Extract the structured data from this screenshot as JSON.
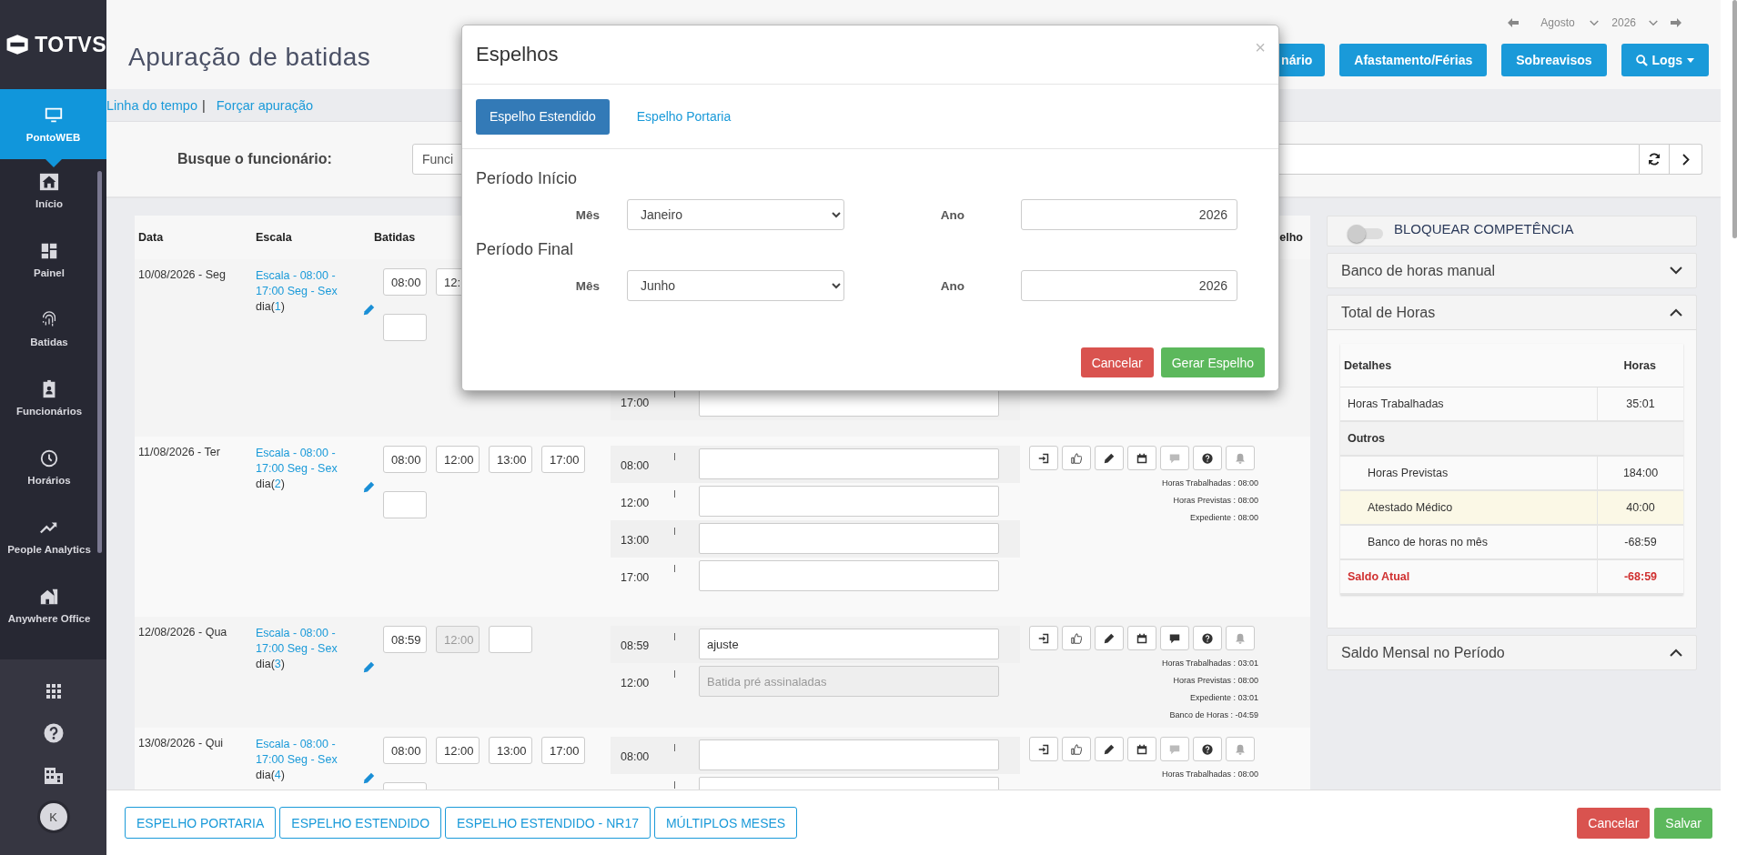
{
  "sidebar": {
    "logo": "TOTVS",
    "avatar": "K",
    "items": [
      {
        "label": "PontoWEB",
        "selected": true
      },
      {
        "label": "Início",
        "selected": false
      },
      {
        "label": "Painel",
        "selected": false
      },
      {
        "label": "Batidas",
        "selected": false
      },
      {
        "label": "Funcionários",
        "selected": false
      },
      {
        "label": "Horários",
        "selected": false
      },
      {
        "label": "People Analytics",
        "selected": false
      },
      {
        "label": "Anywhere Office",
        "selected": false
      }
    ]
  },
  "header": {
    "title": "Apuração de batidas",
    "period": {
      "month": "Agosto",
      "year": "2026"
    },
    "buttons": [
      "nário",
      "Afastamento/Férias",
      "Sobreavisos",
      "Logs"
    ]
  },
  "links": {
    "items": [
      "Linha do tempo",
      "Forçar apuração"
    ],
    "separator": "|"
  },
  "search": {
    "label": "Busque o funcionário:",
    "placeholder": "Funci"
  },
  "table": {
    "columns": [
      "Data",
      "Escala",
      "Batidas",
      "elho"
    ],
    "rows": [
      {
        "date": "10/08/2026 - Seg",
        "escala": "Escala - 08:00 - 17:00 Seg - Sex",
        "day": [
          "dia(",
          "1",
          ")"
        ],
        "punches": [
          {
            "value": "08:00",
            "disabled": false
          },
          {
            "value": "12:",
            "disabled": false
          },
          {
            "break": true,
            "disabled": false
          }
        ],
        "marks": [
          {
            "time": "17:00",
            "disabled": false
          }
        ]
      },
      {
        "date": "11/08/2026 - Ter",
        "escala": "Escala - 08:00 - 17:00 Seg - Sex",
        "day": [
          "dia(",
          "2",
          ")"
        ],
        "punches": [
          {
            "value": "08:00",
            "disabled": false
          },
          {
            "value": "12:00",
            "disabled": false
          },
          {
            "value": "13:00",
            "disabled": false
          },
          {
            "value": "17:00",
            "disabled": false
          },
          {
            "break": true,
            "disabled": false
          }
        ],
        "marks": [
          {
            "time": "08:00",
            "disabled": false
          },
          {
            "time": "12:00",
            "disabled": false
          },
          {
            "time": "13:00",
            "disabled": false
          },
          {
            "time": "17:00",
            "disabled": false
          }
        ],
        "actions": {
          "comment_active": false
        },
        "summary": [
          "Horas Trabalhadas : 08:00",
          "Horas Previstas : 08:00",
          "Expediente : 08:00"
        ]
      },
      {
        "date": "12/08/2026 - Qua",
        "escala": "Escala - 08:00 - 17:00 Seg - Sex",
        "day": [
          "dia(",
          "3",
          ")"
        ],
        "punches": [
          {
            "value": "08:59",
            "disabled": false
          },
          {
            "value": "12:00",
            "disabled": true
          },
          {
            "disabled": false
          }
        ],
        "marks": [
          {
            "time": "08:59",
            "text": "ajuste",
            "disabled": false
          },
          {
            "time": "12:00",
            "placeholder": "Batida pré assinaladas",
            "disabled": true
          }
        ],
        "actions": {
          "comment_active": true
        },
        "summary": [
          "Horas Trabalhadas : 03:01",
          "Horas Previstas : 08:00",
          "Expediente : 03:01",
          "Banco de Horas : -04:59"
        ]
      },
      {
        "date": "13/08/2026 - Qui",
        "escala": "Escala - 08:00 - 17:00 Seg - Sex",
        "day": [
          "dia(",
          "4",
          ")"
        ],
        "punches": [
          {
            "value": "08:00",
            "disabled": false
          },
          {
            "value": "12:00",
            "disabled": false
          },
          {
            "value": "13:00",
            "disabled": false
          },
          {
            "value": "17:00",
            "disabled": false
          },
          {
            "break": true,
            "disabled": false
          }
        ],
        "marks": [
          {
            "time": "08:00",
            "disabled": false
          },
          {
            "disabled": false
          }
        ],
        "actions": {
          "comment_active": false
        },
        "summary": [
          "Horas Trabalhadas : 08:00"
        ]
      }
    ]
  },
  "side_panel": {
    "toggle": {
      "label": "BLOQUEAR COMPETÊNCIA",
      "on": false
    },
    "sections": [
      {
        "title": "Banco de horas manual",
        "expanded": false
      },
      {
        "title": "Total de Horas",
        "expanded": true
      },
      {
        "title": "Saldo Mensal no Período",
        "expanded": true
      }
    ],
    "totals": {
      "columns": [
        "Detalhes",
        "Horas"
      ],
      "rows": [
        {
          "kind": "item",
          "label": "Horas Trabalhadas",
          "value": "35:01",
          "highlighted": false
        },
        {
          "kind": "group",
          "label": "Outros",
          "highlighted": false
        },
        {
          "kind": "sub",
          "label": "Horas Previstas",
          "value": "184:00",
          "highlighted": false
        },
        {
          "kind": "sub",
          "label": "Atestado Médico",
          "value": "40:00",
          "highlighted": true
        },
        {
          "kind": "sub",
          "label": "Banco de horas no mês",
          "value": "-68:59",
          "highlighted": false
        },
        {
          "kind": "total",
          "label": "Saldo Atual",
          "value": "-68:59",
          "highlighted": false
        }
      ]
    }
  },
  "footer": {
    "buttons": [
      "ESPELHO PORTARIA",
      "ESPELHO ESTENDIDO",
      "ESPELHO ESTENDIDO - NR17",
      "MÚLTIPLOS MESES"
    ],
    "cancel": "Cancelar",
    "save": "Salvar"
  },
  "modal": {
    "title": "Espelhos",
    "close": "×",
    "tabs": [
      {
        "label": "Espelho Estendido",
        "selected": true
      },
      {
        "label": "Espelho Portaria",
        "selected": false
      }
    ],
    "periods": [
      {
        "title": "Período Início",
        "month_label": "Mês",
        "month": "Janeiro",
        "year_label": "Ano",
        "year": "2026"
      },
      {
        "title": "Período Final",
        "month_label": "Mês",
        "month": "Junho",
        "year_label": "Ano",
        "year": "2026"
      }
    ],
    "cancel": "Cancelar",
    "confirm": "Gerar Espelho"
  }
}
